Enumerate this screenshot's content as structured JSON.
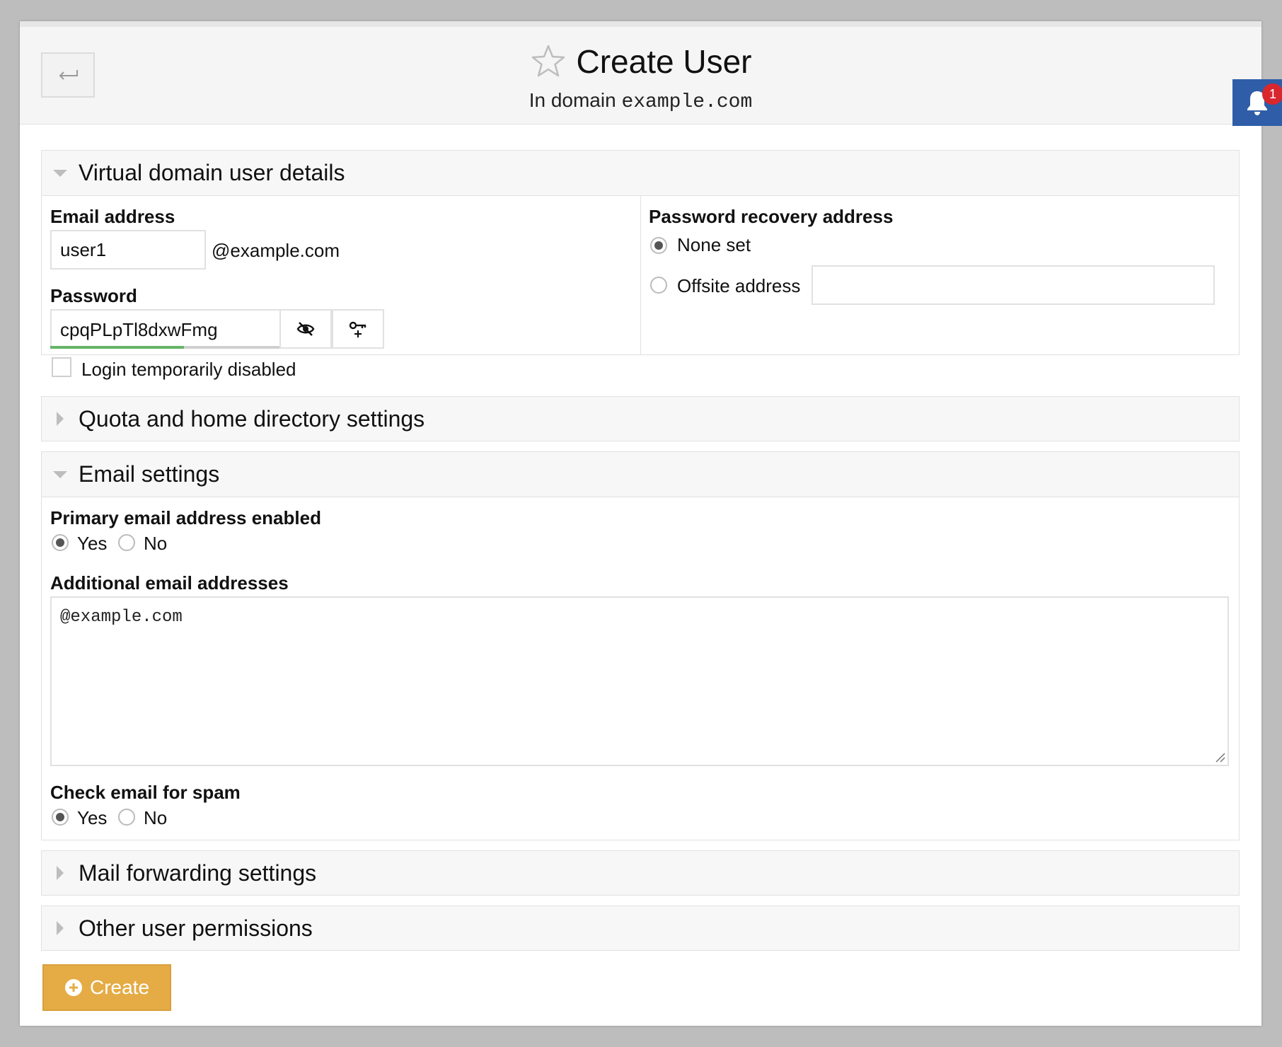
{
  "header": {
    "title": "Create User",
    "subtitle_prefix": "In domain",
    "domain": "example.com"
  },
  "notifications": {
    "count": "1"
  },
  "sections": {
    "details": {
      "title": "Virtual domain user details",
      "email_label": "Email address",
      "email_value": "user1",
      "email_suffix": "@example.com",
      "password_label": "Password",
      "password_value": "cpqPLpTl8dxwFmg",
      "password_strength_fraction": 0.58,
      "login_disabled_label": "Login temporarily disabled",
      "recovery_label": "Password recovery address",
      "recovery_none_label": "None set",
      "recovery_offsite_label": "Offsite address",
      "recovery_offsite_value": ""
    },
    "quota": {
      "title": "Quota and home directory settings"
    },
    "email_settings": {
      "title": "Email settings",
      "primary_label": "Primary email address enabled",
      "yes": "Yes",
      "no": "No",
      "additional_label": "Additional email addresses",
      "additional_value": "@example.com",
      "spam_label": "Check email for spam"
    },
    "forwarding": {
      "title": "Mail forwarding settings"
    },
    "permissions": {
      "title": "Other user permissions"
    }
  },
  "actions": {
    "create_label": "Create"
  },
  "colors": {
    "accent": "#e5ac45",
    "notify_bg": "#2f5da8",
    "badge": "#d9272e",
    "strength": "#64b567"
  }
}
